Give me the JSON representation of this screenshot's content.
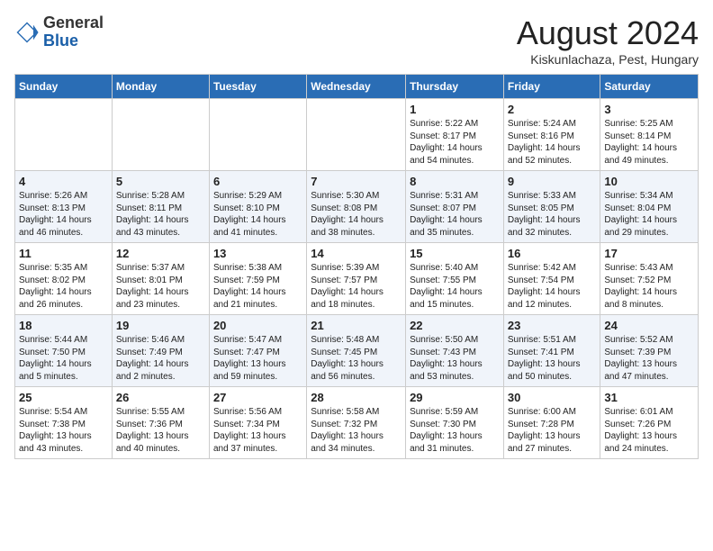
{
  "header": {
    "logo_general": "General",
    "logo_blue": "Blue",
    "month_title": "August 2024",
    "location": "Kiskunlachaza, Pest, Hungary"
  },
  "weekdays": [
    "Sunday",
    "Monday",
    "Tuesday",
    "Wednesday",
    "Thursday",
    "Friday",
    "Saturday"
  ],
  "weeks": [
    [
      {
        "day": "",
        "data": ""
      },
      {
        "day": "",
        "data": ""
      },
      {
        "day": "",
        "data": ""
      },
      {
        "day": "",
        "data": ""
      },
      {
        "day": "1",
        "data": "Sunrise: 5:22 AM\nSunset: 8:17 PM\nDaylight: 14 hours\nand 54 minutes."
      },
      {
        "day": "2",
        "data": "Sunrise: 5:24 AM\nSunset: 8:16 PM\nDaylight: 14 hours\nand 52 minutes."
      },
      {
        "day": "3",
        "data": "Sunrise: 5:25 AM\nSunset: 8:14 PM\nDaylight: 14 hours\nand 49 minutes."
      }
    ],
    [
      {
        "day": "4",
        "data": "Sunrise: 5:26 AM\nSunset: 8:13 PM\nDaylight: 14 hours\nand 46 minutes."
      },
      {
        "day": "5",
        "data": "Sunrise: 5:28 AM\nSunset: 8:11 PM\nDaylight: 14 hours\nand 43 minutes."
      },
      {
        "day": "6",
        "data": "Sunrise: 5:29 AM\nSunset: 8:10 PM\nDaylight: 14 hours\nand 41 minutes."
      },
      {
        "day": "7",
        "data": "Sunrise: 5:30 AM\nSunset: 8:08 PM\nDaylight: 14 hours\nand 38 minutes."
      },
      {
        "day": "8",
        "data": "Sunrise: 5:31 AM\nSunset: 8:07 PM\nDaylight: 14 hours\nand 35 minutes."
      },
      {
        "day": "9",
        "data": "Sunrise: 5:33 AM\nSunset: 8:05 PM\nDaylight: 14 hours\nand 32 minutes."
      },
      {
        "day": "10",
        "data": "Sunrise: 5:34 AM\nSunset: 8:04 PM\nDaylight: 14 hours\nand 29 minutes."
      }
    ],
    [
      {
        "day": "11",
        "data": "Sunrise: 5:35 AM\nSunset: 8:02 PM\nDaylight: 14 hours\nand 26 minutes."
      },
      {
        "day": "12",
        "data": "Sunrise: 5:37 AM\nSunset: 8:01 PM\nDaylight: 14 hours\nand 23 minutes."
      },
      {
        "day": "13",
        "data": "Sunrise: 5:38 AM\nSunset: 7:59 PM\nDaylight: 14 hours\nand 21 minutes."
      },
      {
        "day": "14",
        "data": "Sunrise: 5:39 AM\nSunset: 7:57 PM\nDaylight: 14 hours\nand 18 minutes."
      },
      {
        "day": "15",
        "data": "Sunrise: 5:40 AM\nSunset: 7:55 PM\nDaylight: 14 hours\nand 15 minutes."
      },
      {
        "day": "16",
        "data": "Sunrise: 5:42 AM\nSunset: 7:54 PM\nDaylight: 14 hours\nand 12 minutes."
      },
      {
        "day": "17",
        "data": "Sunrise: 5:43 AM\nSunset: 7:52 PM\nDaylight: 14 hours\nand 8 minutes."
      }
    ],
    [
      {
        "day": "18",
        "data": "Sunrise: 5:44 AM\nSunset: 7:50 PM\nDaylight: 14 hours\nand 5 minutes."
      },
      {
        "day": "19",
        "data": "Sunrise: 5:46 AM\nSunset: 7:49 PM\nDaylight: 14 hours\nand 2 minutes."
      },
      {
        "day": "20",
        "data": "Sunrise: 5:47 AM\nSunset: 7:47 PM\nDaylight: 13 hours\nand 59 minutes."
      },
      {
        "day": "21",
        "data": "Sunrise: 5:48 AM\nSunset: 7:45 PM\nDaylight: 13 hours\nand 56 minutes."
      },
      {
        "day": "22",
        "data": "Sunrise: 5:50 AM\nSunset: 7:43 PM\nDaylight: 13 hours\nand 53 minutes."
      },
      {
        "day": "23",
        "data": "Sunrise: 5:51 AM\nSunset: 7:41 PM\nDaylight: 13 hours\nand 50 minutes."
      },
      {
        "day": "24",
        "data": "Sunrise: 5:52 AM\nSunset: 7:39 PM\nDaylight: 13 hours\nand 47 minutes."
      }
    ],
    [
      {
        "day": "25",
        "data": "Sunrise: 5:54 AM\nSunset: 7:38 PM\nDaylight: 13 hours\nand 43 minutes."
      },
      {
        "day": "26",
        "data": "Sunrise: 5:55 AM\nSunset: 7:36 PM\nDaylight: 13 hours\nand 40 minutes."
      },
      {
        "day": "27",
        "data": "Sunrise: 5:56 AM\nSunset: 7:34 PM\nDaylight: 13 hours\nand 37 minutes."
      },
      {
        "day": "28",
        "data": "Sunrise: 5:58 AM\nSunset: 7:32 PM\nDaylight: 13 hours\nand 34 minutes."
      },
      {
        "day": "29",
        "data": "Sunrise: 5:59 AM\nSunset: 7:30 PM\nDaylight: 13 hours\nand 31 minutes."
      },
      {
        "day": "30",
        "data": "Sunrise: 6:00 AM\nSunset: 7:28 PM\nDaylight: 13 hours\nand 27 minutes."
      },
      {
        "day": "31",
        "data": "Sunrise: 6:01 AM\nSunset: 7:26 PM\nDaylight: 13 hours\nand 24 minutes."
      }
    ]
  ]
}
